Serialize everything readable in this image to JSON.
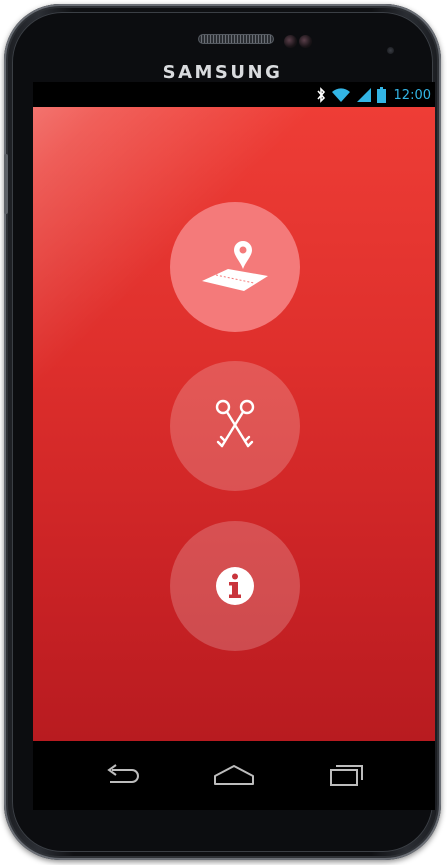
{
  "device": {
    "brand": "SAMSUNG"
  },
  "status_bar": {
    "time": "12:00",
    "icons": [
      "bluetooth-icon",
      "wifi-icon",
      "signal-icon",
      "battery-icon"
    ],
    "icon_color": "#33b5e5"
  },
  "main": {
    "buttons": [
      {
        "name": "map-location-button",
        "icon": "map-pin-icon",
        "state": "active",
        "color": "#f47a7a"
      },
      {
        "name": "keys-button",
        "icon": "crossed-keys-icon",
        "state": "inactive"
      },
      {
        "name": "info-button",
        "icon": "info-icon",
        "state": "inactive"
      }
    ],
    "background_colors": [
      "#ee3d36",
      "#b81b20"
    ]
  },
  "navigation_bar": {
    "buttons": [
      "back-icon",
      "home-icon",
      "recent-apps-icon"
    ]
  }
}
